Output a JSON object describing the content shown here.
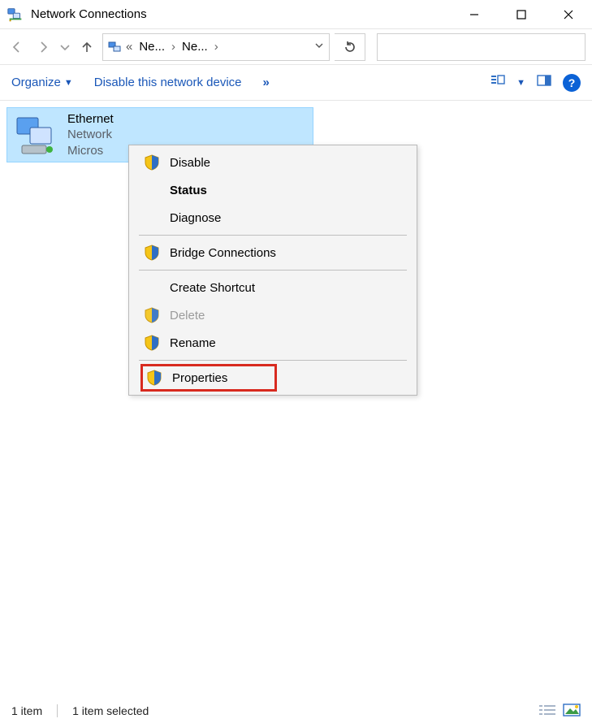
{
  "window": {
    "title": "Network Connections"
  },
  "address": {
    "crumb1": "Ne...",
    "crumb2": "Ne..."
  },
  "toolbar": {
    "organize": "Organize",
    "disable": "Disable this network device",
    "overflow": "»"
  },
  "item": {
    "name": "Ethernet",
    "line2": "Network",
    "line3": "Micros"
  },
  "context_menu": {
    "disable": "Disable",
    "status": "Status",
    "diagnose": "Diagnose",
    "bridge": "Bridge Connections",
    "create_shortcut": "Create Shortcut",
    "delete": "Delete",
    "rename": "Rename",
    "properties": "Properties"
  },
  "status": {
    "count": "1 item",
    "selected": "1 item selected"
  }
}
